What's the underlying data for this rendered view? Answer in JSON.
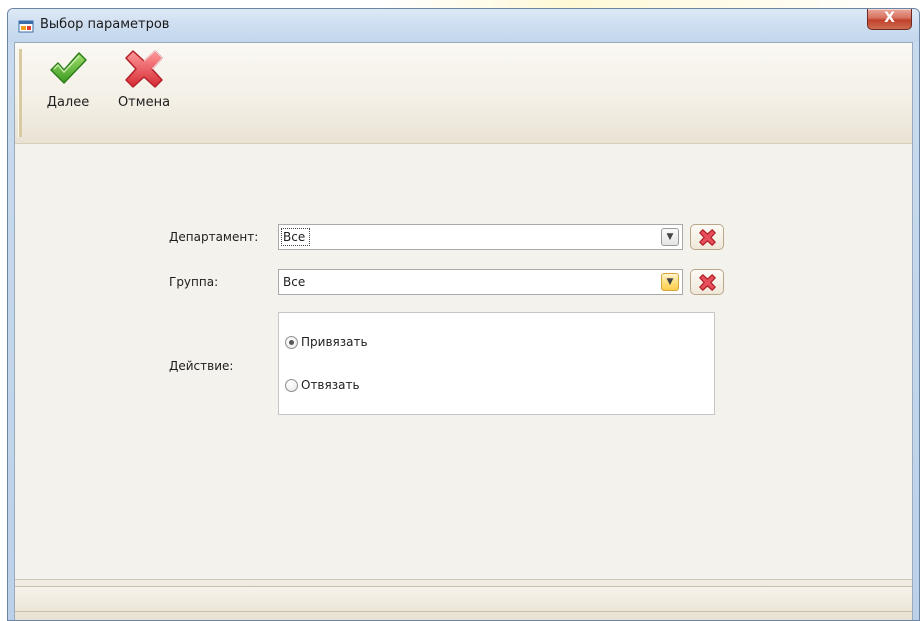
{
  "window": {
    "title": "Выбор параметров",
    "close_glyph": "X"
  },
  "toolbar": {
    "next_label": "Далее",
    "next_icon": "checkmark-icon",
    "cancel_label": "Отмена",
    "cancel_icon": "red-cross-icon"
  },
  "form": {
    "department": {
      "label": "Департамент:",
      "value": "Все"
    },
    "group": {
      "label": "Группа:",
      "value": "Все"
    },
    "action": {
      "label": "Действие:",
      "options": [
        {
          "label": "Привязать",
          "checked": true
        },
        {
          "label": "Отвязать",
          "checked": false
        }
      ]
    }
  },
  "colors": {
    "accent_check": "#5fb336",
    "accent_cross": "#e0414b",
    "client_bg": "#f4f2ec"
  }
}
